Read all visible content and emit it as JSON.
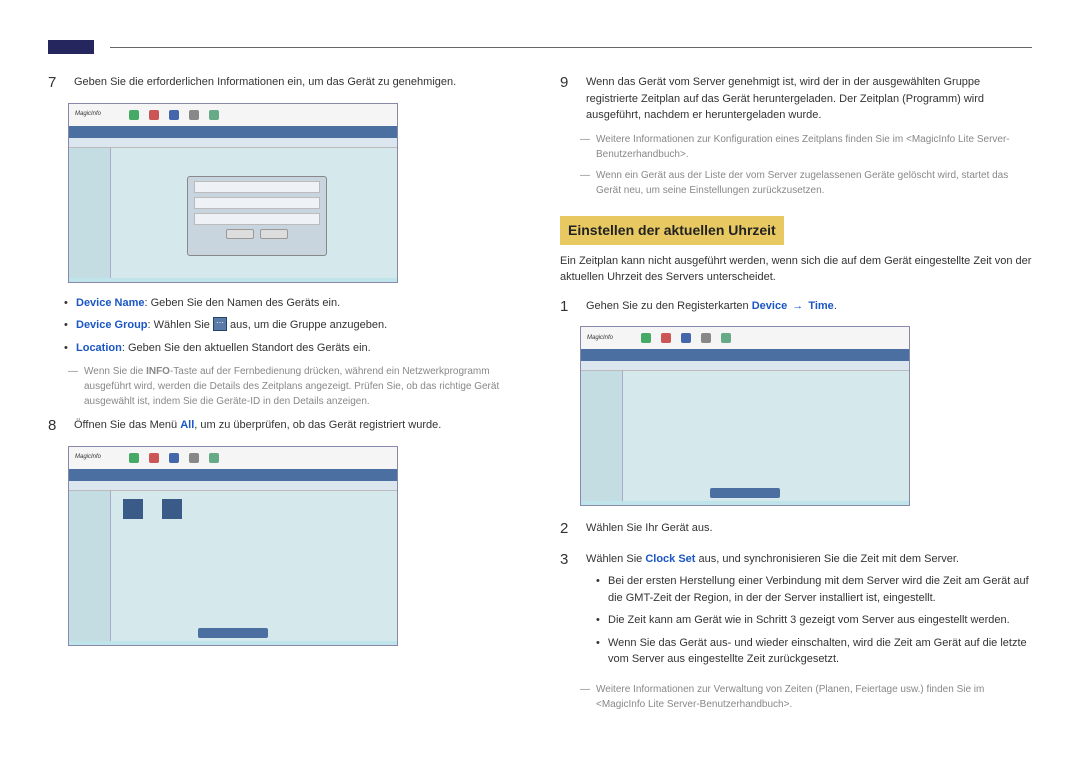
{
  "col1": {
    "step7": {
      "num": "7",
      "text": "Geben Sie die erforderlichen Informationen ein, um das Gerät zu genehmigen.",
      "b1a": "Device Name",
      "b1b": ": Geben Sie den Namen des Geräts ein.",
      "b2a": "Device Group",
      "b2b1": ": Wählen Sie ",
      "b2b2": " aus, um die Gruppe anzugeben.",
      "b3a": "Location",
      "b3b": ": Geben Sie den aktuellen Standort des Geräts ein.",
      "note1a": "Wenn Sie die ",
      "note1b": "INFO",
      "note1c": "-Taste auf der Fernbedienung drücken, während ein Netzwerkprogramm ausgeführt wird, werden die Details des Zeitplans angezeigt. Prüfen Sie, ob das richtige Gerät ausgewählt ist, indem Sie die Geräte-ID in den Details anzeigen."
    },
    "step8": {
      "num": "8",
      "t1": "Öffnen Sie das Menü ",
      "t2": "All",
      "t3": ", um zu überprüfen, ob das Gerät registriert wurde."
    }
  },
  "col2": {
    "step9": {
      "num": "9",
      "text": "Wenn das Gerät vom Server genehmigt ist, wird der in der ausgewählten Gruppe registrierte Zeitplan auf das Gerät heruntergeladen. Der Zeitplan (Programm) wird ausgeführt, nachdem er heruntergeladen wurde.",
      "note1": "Weitere Informationen zur Konfiguration eines Zeitplans finden Sie im <MagicInfo Lite Server-Benutzerhandbuch>.",
      "note2": "Wenn ein Gerät aus der Liste der vom Server zugelassenen Geräte gelöscht wird, startet das Gerät neu, um seine Einstellungen zurückzusetzen."
    },
    "hdr": "Einstellen der aktuellen Uhrzeit",
    "intro": "Ein Zeitplan kann nicht ausgeführt werden, wenn sich die auf dem Gerät eingestellte Zeit von der aktuellen Uhrzeit des Servers unterscheidet.",
    "step1": {
      "num": "1",
      "t1": "Gehen Sie zu den Registerkarten ",
      "t2": "Device",
      "arr": " → ",
      "t3": "Time",
      "t4": "."
    },
    "step2": {
      "num": "2",
      "text": "Wählen Sie Ihr Gerät aus."
    },
    "step3": {
      "num": "3",
      "t1": "Wählen Sie ",
      "t2": "Clock Set",
      "t3": " aus, und synchronisieren Sie die Zeit mit dem Server.",
      "b1": "Bei der ersten Herstellung einer Verbindung mit dem Server wird die Zeit am Gerät auf die GMT-Zeit der Region, in der der Server installiert ist, eingestellt.",
      "b2": "Die Zeit kann am Gerät wie in Schritt 3 gezeigt vom Server aus eingestellt werden.",
      "b3": "Wenn Sie das Gerät aus- und wieder einschalten, wird die Zeit am Gerät auf die letzte vom Server aus eingestellte Zeit zurückgesetzt.",
      "note": "Weitere Informationen zur Verwaltung von Zeiten (Planen, Feiertage usw.) finden Sie im <MagicInfo Lite Server-Benutzerhandbuch>."
    }
  }
}
